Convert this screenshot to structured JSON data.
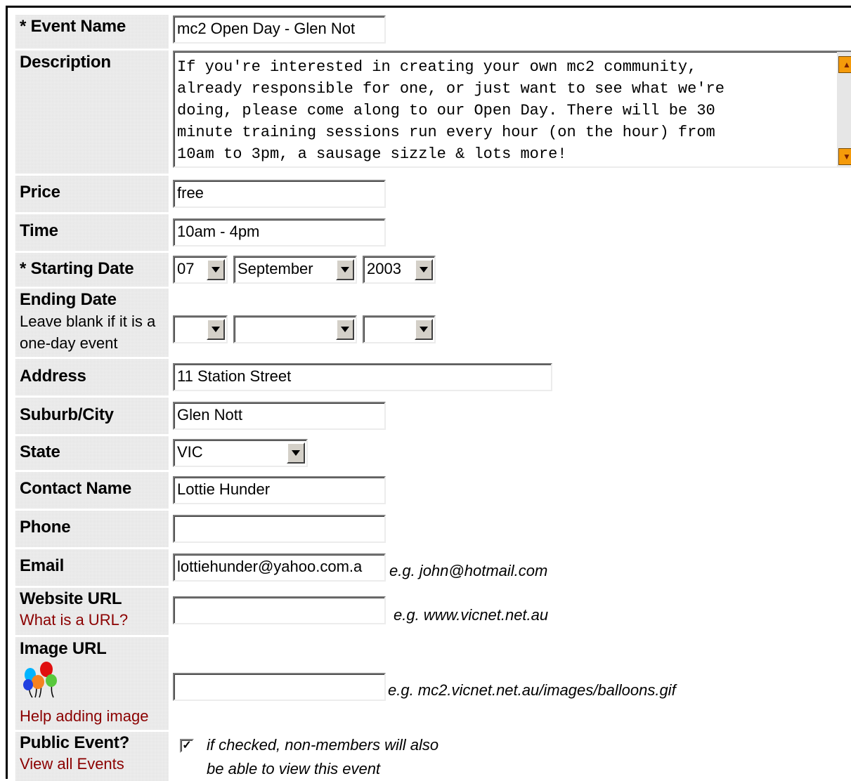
{
  "form": {
    "event_name": {
      "label": "* Event Name",
      "value": "mc2 Open Day - Glen Not"
    },
    "description": {
      "label": "Description",
      "value": "If you're interested in creating your own mc2 community,\nalready responsible for one, or just want to see what we're\ndoing, please come along to our Open Day. There will be 30\nminute training sessions run every hour (on the hour) from\n10am to 3pm, a sausage sizzle & lots more!"
    },
    "price": {
      "label": "Price",
      "value": "free"
    },
    "time": {
      "label": "Time",
      "value": "10am - 4pm"
    },
    "starting_date": {
      "label": "* Starting Date",
      "day": "07",
      "month": "September",
      "year": "2003"
    },
    "ending_date": {
      "label": "Ending Date",
      "note": "Leave blank if it is a one-day event",
      "day": "",
      "month": "",
      "year": ""
    },
    "address": {
      "label": "Address",
      "value": "11 Station Street"
    },
    "suburb": {
      "label": "Suburb/City",
      "value": "Glen Nott"
    },
    "state": {
      "label": "State",
      "value": "VIC"
    },
    "contact_name": {
      "label": "Contact Name",
      "value": "Lottie Hunder"
    },
    "phone": {
      "label": "Phone",
      "value": ""
    },
    "email": {
      "label": "Email",
      "value": "lottiehunder@yahoo.com.a",
      "hint": "e.g. john@hotmail.com"
    },
    "website": {
      "label": "Website URL",
      "help_link": "What is a URL?",
      "value": "",
      "hint": "e.g. www.vicnet.net.au"
    },
    "image_url": {
      "label": "Image URL",
      "help_link": "Help adding image",
      "value": "",
      "hint": "e.g. mc2.vicnet.net.au/images/balloons.gif",
      "icon": "balloons-icon"
    },
    "public_event": {
      "label": "Public Event?",
      "link": "View all Events",
      "checked": true,
      "check_mark": "✓",
      "text_line1": "if checked, non-members will also",
      "text_line2": "be able to view this event"
    }
  },
  "colors": {
    "link": "#8b0000",
    "scroll_arrow": "#f59b0a",
    "label_bg": "#f2f2f2"
  }
}
